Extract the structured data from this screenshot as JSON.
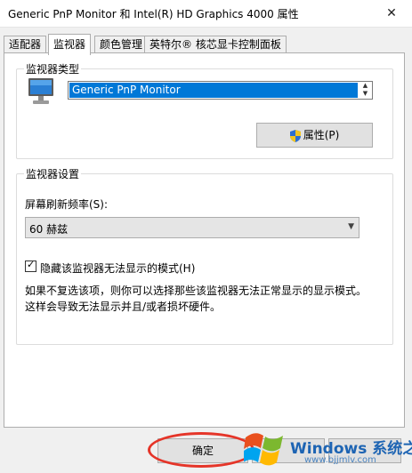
{
  "window": {
    "title": "Generic PnP Monitor 和 Intel(R) HD Graphics 4000 属性",
    "close_glyph": "✕"
  },
  "tabs": [
    {
      "label": "适配器"
    },
    {
      "label": "监视器"
    },
    {
      "label": "颜色管理"
    },
    {
      "label": "英特尔® 核芯显卡控制面板"
    }
  ],
  "monitor_type": {
    "group_title": "监视器类型",
    "selected_monitor": "Generic PnP Monitor",
    "properties_button": "属性(P)"
  },
  "monitor_settings": {
    "group_title": "监视器设置",
    "refresh_label": "屏幕刷新频率(S):",
    "refresh_value": "60 赫兹",
    "hide_modes_label": "隐藏该监视器无法显示的模式(H)",
    "hide_modes_checked": true,
    "note_line1": "如果不复选该项，则你可以选择那些该监视器无法正常显示的显示模式。",
    "note_line2": "这样会导致无法显示并且/或者损坏硬件。"
  },
  "footer": {
    "ok_label": "确定",
    "cancel_label": "",
    "apply_label": ""
  },
  "watermark": {
    "brand": "Windows",
    "brand_cn": "系统之家",
    "url": "www.bjjmlv.com"
  },
  "colors": {
    "accent": "#0078d7",
    "annotation": "#e53529",
    "watermark": "#1d64b3"
  }
}
